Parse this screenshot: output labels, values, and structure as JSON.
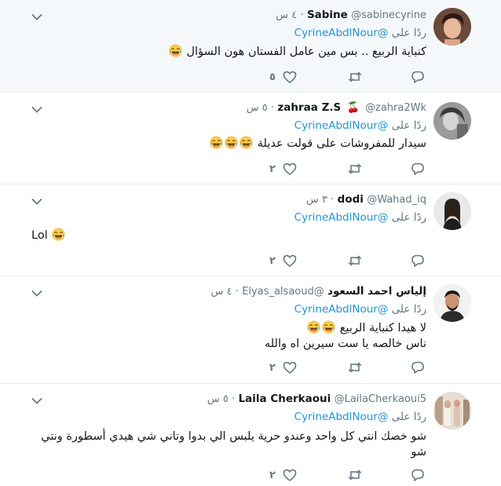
{
  "reply_prefix": "ردًا على",
  "tweets": [
    {
      "name": "Sabine",
      "handle": "@sabinecyrine",
      "dot": "·",
      "time": "٤ س",
      "reply_to": "@CyrineAbdlNour",
      "lines": [
        "كنباية الربيع .. بس مين عامل الفستان هون السؤال"
      ],
      "like_count": "٥",
      "highlighted": true
    },
    {
      "name": "zahraa Z.S",
      "handle": "@zahra2Wk",
      "dot": "·",
      "time": "٥ س",
      "reply_to": "@CyrineAbdlNour",
      "lines": [
        "سيدار للمفروشات على قولت عديلة"
      ],
      "like_count": "٢",
      "name_emoji": "🍒"
    },
    {
      "name": "dodi",
      "handle": "@Wahad_iq",
      "dot": "·",
      "time": "٣ س",
      "reply_to": "@CyrineAbdlNour",
      "lines": [
        "Lol"
      ],
      "like_count": "٢"
    },
    {
      "name": "إلياس احمد السعود",
      "handle": "@Elyas_alsaoud",
      "dot": "·",
      "time": "٤ س",
      "reply_to": "@CyrineAbdlNour",
      "lines": [
        "لا هيدا كنباية الربيع",
        "ناس خالصه يا ست سيرين اه والله"
      ],
      "like_count": "٢"
    },
    {
      "name": "Laila Cherkaoui",
      "handle": "@LailaCherkaoui5",
      "dot": "·",
      "time": "٥ س",
      "reply_to": "@CyrineAbdlNour",
      "lines": [
        "شو خصك انتي كل واحد وعندو حرية يلبس الي بدوا وتاني شي هيدي أسطورة ونتي",
        "شو"
      ],
      "like_count": "٢"
    }
  ],
  "icons": {
    "caret": "chevron-down-icon",
    "reply": "reply-icon",
    "retweet": "retweet-icon",
    "like": "heart-icon",
    "emoji": "face-with-tears-of-joy-emoji"
  },
  "colors": {
    "mention": "#1b95e0",
    "muted": "#657786",
    "highlight_bg": "#f5f8fa",
    "border": "#e6ecf0"
  }
}
